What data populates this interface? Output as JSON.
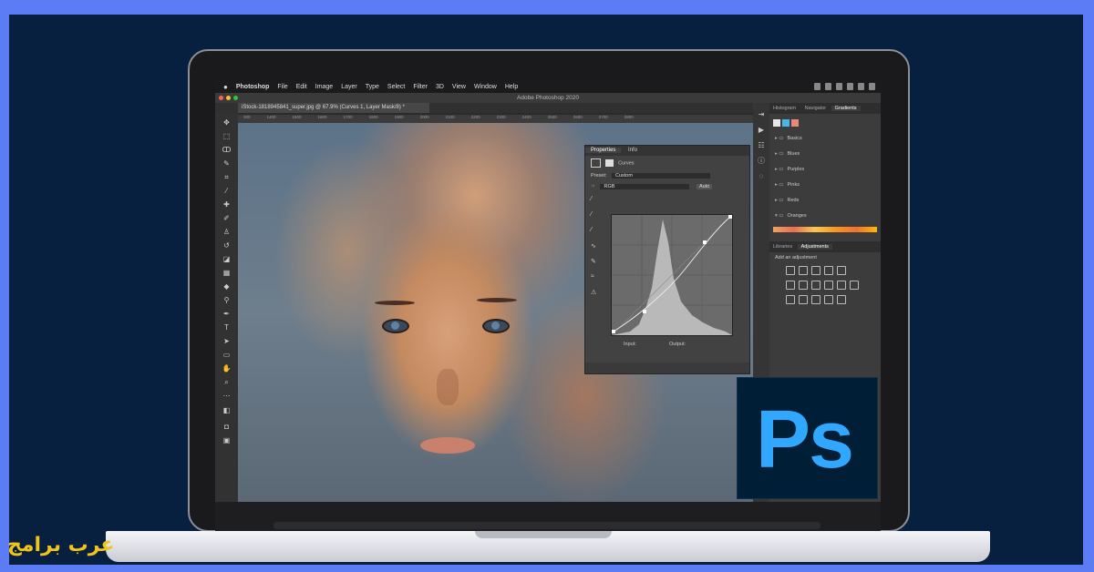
{
  "menubar": {
    "apple": "",
    "items": [
      "Photoshop",
      "File",
      "Edit",
      "Image",
      "Layer",
      "Type",
      "Select",
      "Filter",
      "3D",
      "View",
      "Window",
      "Help"
    ]
  },
  "title": "Adobe Photoshop 2020",
  "document_tab": "iStock-1818945841_super.jpg @ 67.9% (Curves 1, Layer Mask/8) *",
  "ruler_ticks": [
    "300",
    "1400",
    "1500",
    "1600",
    "1700",
    "1800",
    "1900",
    "2000",
    "2100",
    "2200",
    "2300",
    "2400",
    "2500",
    "2600",
    "2700",
    "2800"
  ],
  "properties": {
    "tabs": [
      "Properties",
      "Info"
    ],
    "adjustment_name": "Curves",
    "preset_label": "Preset:",
    "preset_value": "Custom",
    "channel_value": "RGB",
    "auto_label": "Auto",
    "input_label": "Input:",
    "output_label": "Output:"
  },
  "right_panel": {
    "top_tabs": [
      "Histogram",
      "Navigator",
      "Gradients"
    ],
    "swatch_colors": [
      "#e8e8e8",
      "#49b6e6",
      "#e88a7a"
    ],
    "gradient_groups": [
      "Basics",
      "Blues",
      "Purples",
      "Pinks",
      "Reds",
      "Oranges"
    ],
    "bottom_tabs": [
      "Libraries",
      "Adjustments"
    ],
    "adjustments_label": "Add an adjustment"
  },
  "logo": {
    "text": "Ps"
  },
  "watermark": "عرب برامج",
  "colors": {
    "background": "#5b7cf5",
    "stage": "#08203f",
    "ps_blue": "#31a8ff",
    "ps_bg": "#001e36",
    "watermark": "#f0c419"
  }
}
